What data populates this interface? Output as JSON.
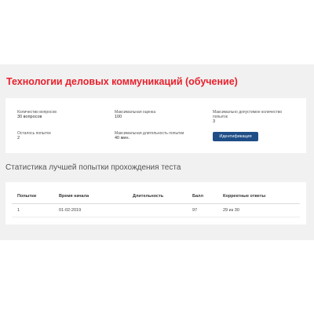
{
  "page": {
    "title": "Технологии деловых коммуникаций (обучение)"
  },
  "info": {
    "questions_label": "Количество вопросов",
    "questions_value": "30 вопросов",
    "max_score_label": "Максимальная оценка",
    "max_score_value": "100",
    "max_attempts_label": "Максимально допустимое количество попыток",
    "max_attempts_value": "3",
    "attempts_left_label": "Осталось попыток",
    "attempts_left_value": "2",
    "max_duration_label": "Максимальная длительность попытки",
    "max_duration_value": "40 мин.",
    "identify_button": "Идентификация"
  },
  "stats": {
    "title": "Статистика лучшей попытки прохождения теста",
    "columns": [
      "Попытки",
      "Время начала",
      "Длительность",
      "Балл",
      "Корректные ответы"
    ],
    "rows": [
      [
        "1",
        "01-02-2019",
        "",
        "97",
        "29 из 30"
      ]
    ]
  },
  "colors": {
    "title": "#e8202c",
    "button": "#1f4e87",
    "panel": "#f1f1f1"
  }
}
